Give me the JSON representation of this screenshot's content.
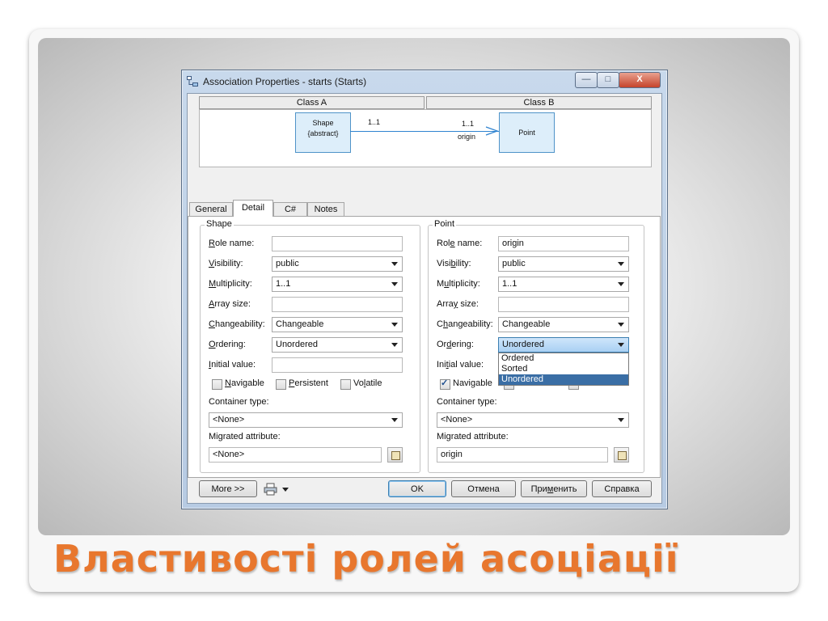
{
  "window": {
    "title": "Association Properties - starts (Starts)",
    "min_glyph": "—",
    "max_glyph": "□",
    "close_glyph": "X"
  },
  "header": {
    "class_a": "Class A",
    "class_b": "Class B"
  },
  "diagram": {
    "class_a_name": "Shape",
    "class_a_stereotype": "{abstract}",
    "class_a_multiplicity": "1..1",
    "class_b_name": "Point",
    "class_b_multiplicity": "1..1",
    "class_b_role": "origin"
  },
  "tabs": [
    {
      "label": "General"
    },
    {
      "label": "Detail"
    },
    {
      "label": "C#"
    },
    {
      "label": "Notes"
    }
  ],
  "labels": {
    "role_name": [
      "",
      "R",
      "ole name:"
    ],
    "visibility": [
      "",
      "V",
      "isibility:"
    ],
    "multiplicity": [
      "",
      "M",
      "ultiplicity:"
    ],
    "array_size": [
      "",
      "A",
      "rray size:"
    ],
    "changeability": [
      "",
      "C",
      "hangeability:"
    ],
    "ordering": [
      "",
      "O",
      "rdering:"
    ],
    "initial_value": [
      "",
      "I",
      "nitial value:"
    ],
    "navigable": [
      "",
      "N",
      "avigable"
    ],
    "persistent": [
      "",
      "P",
      "ersistent"
    ],
    "volatile": [
      "Vo",
      "l",
      "atile"
    ],
    "container_type": "Container type:",
    "migrated_attribute": "Migrated attribute:"
  },
  "labels_b": {
    "role_name": [
      "Rol",
      "e",
      " name:"
    ],
    "visibility": [
      "Visi",
      "b",
      "ility:"
    ],
    "multiplicity": [
      "M",
      "u",
      "ltiplicity:"
    ],
    "array_size": [
      "Arra",
      "y",
      " size:"
    ],
    "changeability": [
      "C",
      "h",
      "angeability:"
    ],
    "ordering": [
      "Or",
      "d",
      "ering:"
    ],
    "initial_value": [
      "Ini",
      "t",
      "ial value:"
    ],
    "navigable": [
      "",
      "",
      "Navigable"
    ]
  },
  "class_a": {
    "group_title": "Shape",
    "role_name": "",
    "visibility": "public",
    "multiplicity": "1..1",
    "array_size": "",
    "changeability": "Changeable",
    "ordering": "Unordered",
    "initial_value": "",
    "navigable": false,
    "persistent": false,
    "volatile": false,
    "container_type": "<None>",
    "migrated_attribute": "<None>"
  },
  "class_b": {
    "group_title": "Point",
    "role_name": "origin",
    "visibility": "public",
    "multiplicity": "1..1",
    "array_size": "",
    "changeability": "Changeable",
    "ordering": "Unordered",
    "initial_value": "",
    "navigable": true,
    "container_type": "<None>",
    "migrated_attribute": "origin",
    "ordering_options": [
      "Ordered",
      "Sorted",
      "Unordered"
    ],
    "ordering_selected_index": 2
  },
  "buttons": {
    "more": "More >>",
    "ok": "OK",
    "cancel": "Отмена",
    "apply": [
      "При",
      "м",
      "енить"
    ],
    "help": "Справка"
  },
  "slide_title": "Властивості ролей асоціації",
  "colors": {
    "title_orange": "#e8772e",
    "selection_blue": "#3a6ea5",
    "uml_fill": "#ddeefa"
  }
}
